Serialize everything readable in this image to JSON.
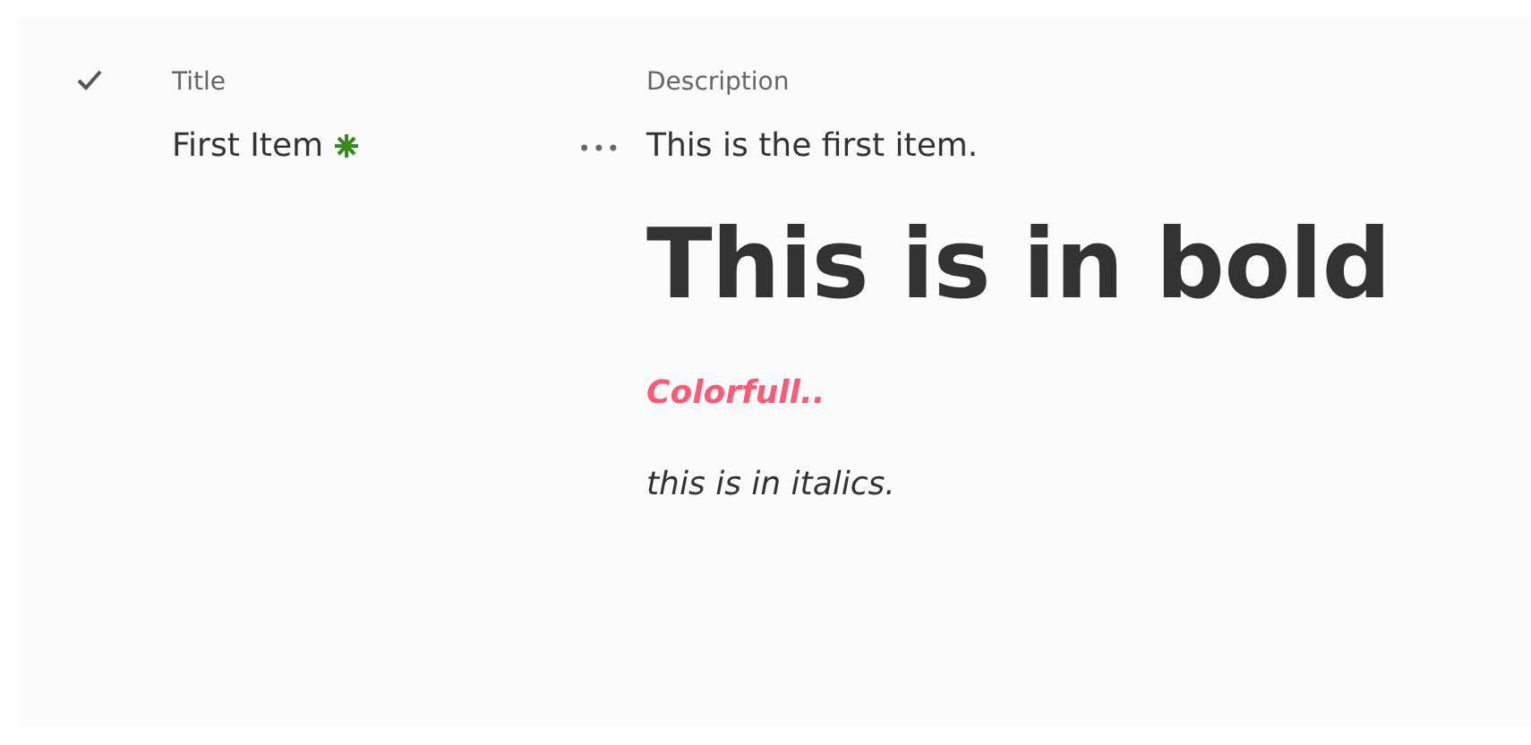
{
  "list": {
    "columns": [
      {
        "kind": "check"
      },
      {
        "kind": "text",
        "label": "Title"
      },
      {
        "kind": "text",
        "label": "Description"
      }
    ],
    "rows": [
      {
        "title": "First Item",
        "is_new": true,
        "more": "•••",
        "description": [
          {
            "kind": "text",
            "text": "This is the first item."
          },
          {
            "kind": "heading",
            "text": "This is in bold"
          },
          {
            "kind": "colored",
            "text": "Colorfull..",
            "color": "#ff5a78"
          },
          {
            "kind": "italic",
            "text": "this is in italics."
          }
        ]
      }
    ]
  }
}
